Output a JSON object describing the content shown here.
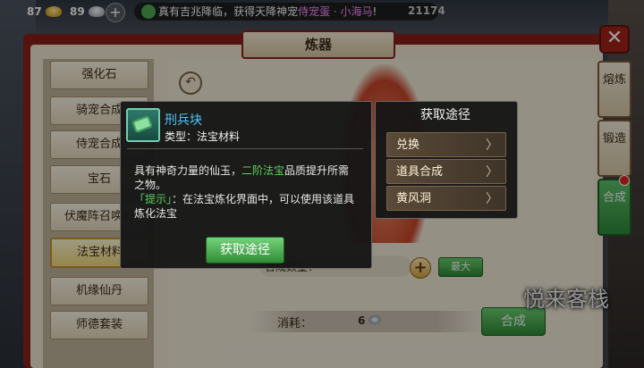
{
  "topbar": {
    "gold": "87",
    "silver": "89",
    "plus": "+",
    "marquee_prefix": "真有吉兆降临，获得天降神宠",
    "marquee_pet": "侍宠蛋 · 小海马",
    "marquee_suffix": "!",
    "right_number": "21174"
  },
  "window": {
    "title": "炼器",
    "close": "✕"
  },
  "left_menu": {
    "items": [
      {
        "label": "强化石"
      },
      {
        "label": "骑宠合成"
      },
      {
        "label": "侍宠合成"
      },
      {
        "label": "宝石"
      },
      {
        "label": "伏魔阵召唤石"
      },
      {
        "label": "法宝材料"
      },
      {
        "label": "机缘仙丹"
      },
      {
        "label": "师德套装"
      }
    ],
    "selected_index": 5
  },
  "right_tabs": {
    "items": [
      {
        "label": "熔炼"
      },
      {
        "label": "锻造"
      },
      {
        "label": "合成"
      }
    ],
    "active": "合成"
  },
  "content": {
    "quantity_label": "合成数量：",
    "plus": "+",
    "max_label": "最大",
    "consume_label": "消耗：",
    "consume_value": "6",
    "synth_label": "合成",
    "logo": "悦来客栈"
  },
  "tooltip": {
    "name": "刑兵块",
    "type": "类型：法宝材料",
    "desc_1": "具有神奇力量的仙玉，",
    "desc_hl": "二阶法宝",
    "desc_2": "品质提升所需之物。",
    "tip_hl": "「提示」",
    "tip_text": "：在法宝炼化界面中，可以使用该道具炼化法宝",
    "button": "获取途径"
  },
  "acquire": {
    "title": "获取途径",
    "items": [
      {
        "label": "兑换"
      },
      {
        "label": "道具合成"
      },
      {
        "label": "黄风洞"
      }
    ],
    "chevron": "〉"
  },
  "colors": {
    "frame_red": "#8a1f19",
    "accent_green": "#2e8a35",
    "item_name_blue": "#4ec8ff",
    "highlight_green": "#5ad35a",
    "marquee_pink": "#ff8cff"
  }
}
